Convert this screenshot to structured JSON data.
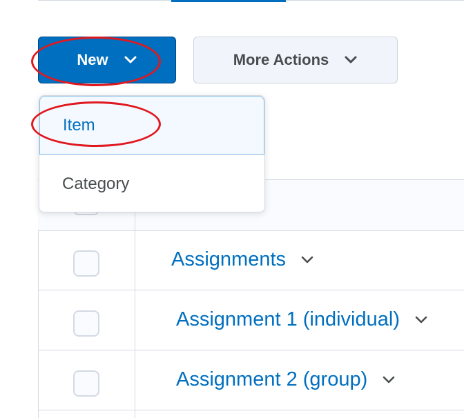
{
  "toolbar": {
    "new_label": "New",
    "more_actions_label": "More Actions"
  },
  "new_menu": {
    "items": [
      {
        "label": "Item",
        "highlighted": true
      },
      {
        "label": "Category",
        "highlighted": false
      }
    ]
  },
  "grid": {
    "rows": [
      {
        "label": "Assignments"
      },
      {
        "label": "Assignment 1 (individual)"
      },
      {
        "label": "Assignment 2 (group)"
      }
    ]
  },
  "icons": {
    "dropdown": "chevron-down-icon"
  },
  "colors": {
    "primary": "#006fbf",
    "annotation": "#e0191f",
    "secondary_button_bg": "#f1f5fb",
    "text_gray": "#494c4e"
  }
}
